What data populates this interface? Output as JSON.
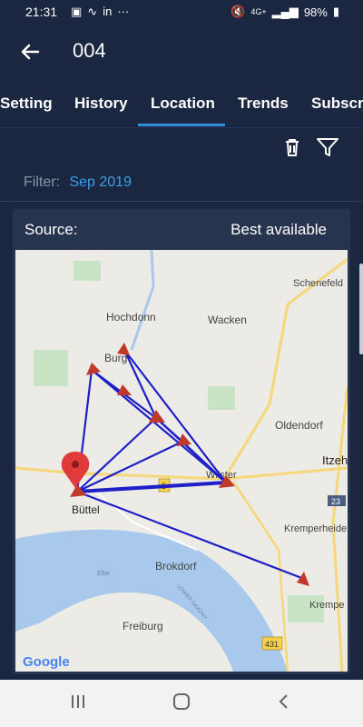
{
  "status_bar": {
    "time": "21:31",
    "battery": "98%",
    "network": "4G+"
  },
  "app_bar": {
    "title": "004"
  },
  "tabs": [
    {
      "label": "Setting"
    },
    {
      "label": "History"
    },
    {
      "label": "Location"
    },
    {
      "label": "Trends"
    },
    {
      "label": "Subscri"
    }
  ],
  "filter": {
    "label": "Filter:",
    "value": "Sep 2019"
  },
  "source": {
    "label": "Source:",
    "value": "Best available"
  },
  "map": {
    "places": [
      "Schenefeld",
      "Hochdonn",
      "Wacken",
      "Burg",
      "Oldendorf",
      "Itzehoe",
      "Wilster",
      "Büttel",
      "Kremperheide",
      "Brokdorf",
      "Elbe",
      "LOWER SAXONY",
      "Krempe",
      "Freiburg",
      "Google"
    ],
    "road_shields": [
      "5",
      "23",
      "431"
    ]
  },
  "colors": {
    "background": "#1b2640",
    "accent": "#2f8fdc",
    "route": "#1f1fc8",
    "marker": "#c0392b"
  }
}
